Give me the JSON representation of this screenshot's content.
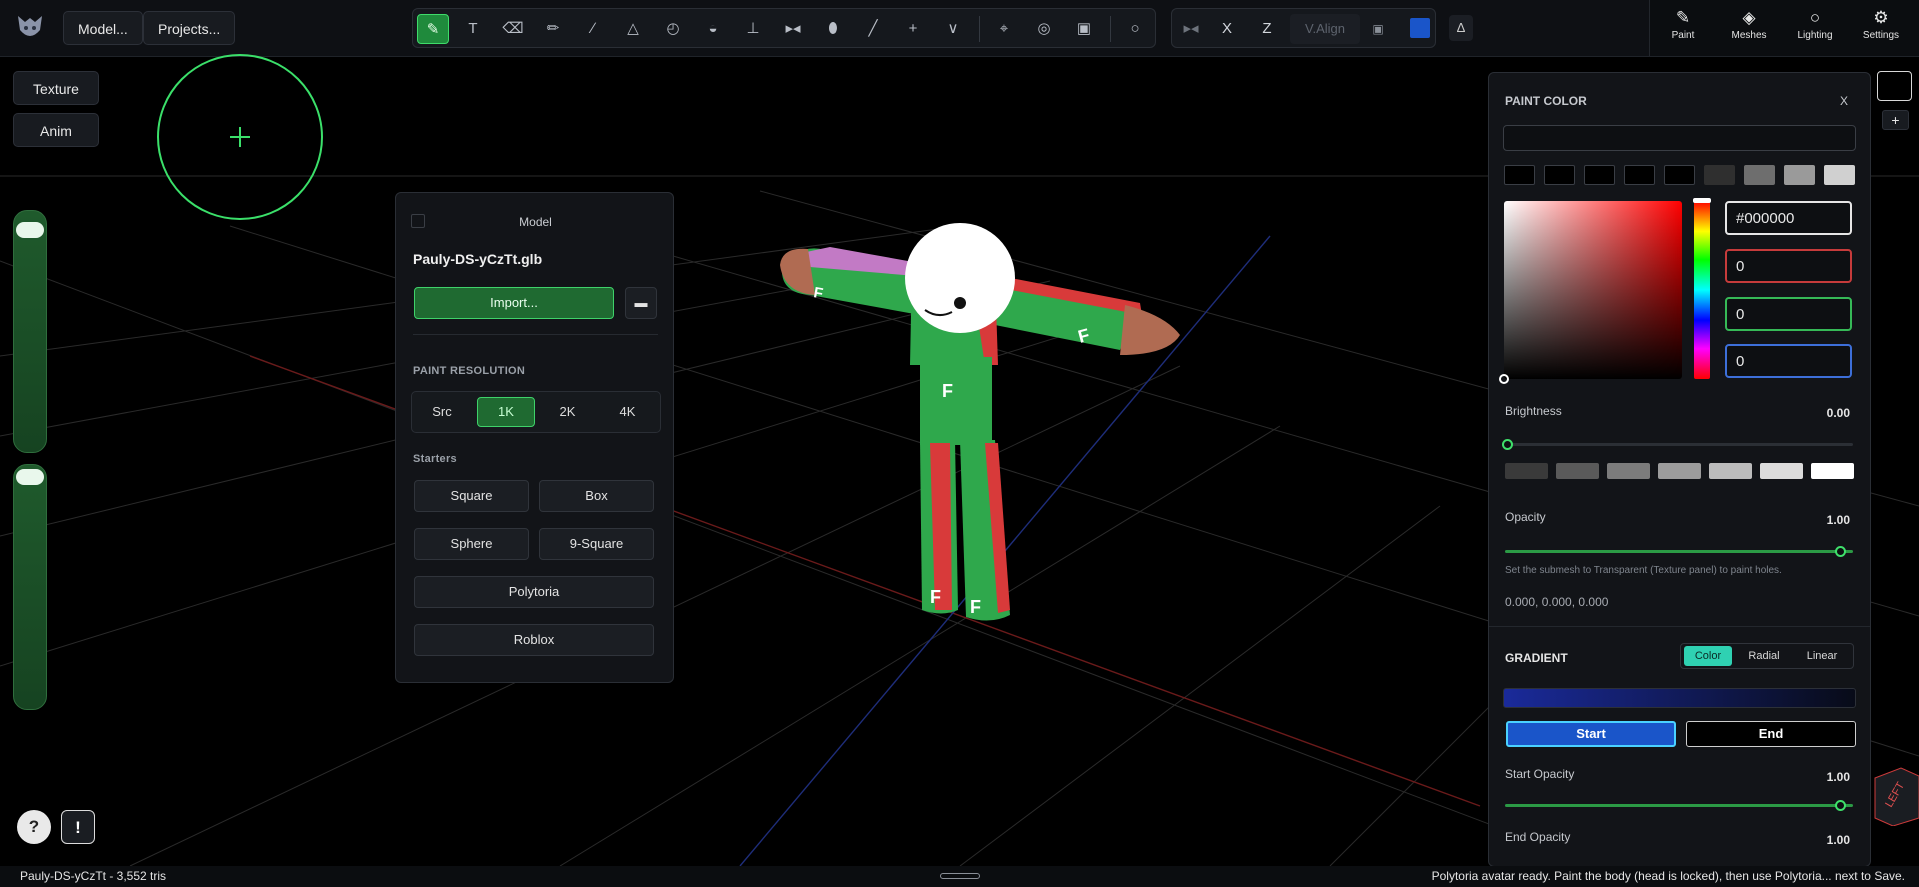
{
  "header": {
    "menus": [
      "Model...",
      "Projects..."
    ],
    "tools": [
      "brush-icon",
      "text-icon",
      "eraser-icon",
      "pencil-icon",
      "line-icon",
      "triangle-icon",
      "bucket-icon",
      "fill-icon",
      "stamp-icon",
      "mirror-icon",
      "ellipse-icon",
      "eyedropper-icon",
      "plus-icon",
      "chevron-down-icon",
      "target-icon",
      "crosshair-icon",
      "lock-icon",
      "lightbulb-icon"
    ],
    "axis": {
      "x_label": "X",
      "z_label": "Z",
      "valign_placeholder": "V.Align"
    },
    "accent_color": "#1a55c9",
    "right_nav": [
      {
        "label": "Paint",
        "icon": "brush-icon"
      },
      {
        "label": "Meshes",
        "icon": "layers-icon"
      },
      {
        "label": "Lighting",
        "icon": "lightbulb-icon"
      },
      {
        "label": "Settings",
        "icon": "gear-icon"
      }
    ]
  },
  "left": {
    "buttons": [
      "Texture",
      "Anim"
    ],
    "help_label": "?",
    "alert_label": "!"
  },
  "model_panel": {
    "title": "Model",
    "filename": "Pauly-DS-yCzTt.glb",
    "import_label": "Import...",
    "resolution_label": "PAINT RESOLUTION",
    "resolutions": [
      "Src",
      "1K",
      "2K",
      "4K"
    ],
    "active_resolution": "1K",
    "starters_label": "Starters",
    "starters": [
      "Square",
      "Box",
      "Sphere",
      "9-Square",
      "Polytoria",
      "Roblox"
    ]
  },
  "paint_panel": {
    "title": "PAINT COLOR",
    "close_label": "X",
    "swatches": [
      "#000000",
      "#000000",
      "#000000",
      "#000000",
      "#000000",
      "#2f2f2f",
      "#6e6e6e",
      "#9a9a9a",
      "#d0d0d0"
    ],
    "hex_value": "#000000",
    "rgb": [
      "0",
      "0",
      "0"
    ],
    "brightness_label": "Brightness",
    "brightness_value": "0.00",
    "gray_swatches": [
      "#3a3a3a",
      "#5a5a5a",
      "#7c7c7c",
      "#9c9c9c",
      "#bcbcbc",
      "#dcdcdc",
      "#ffffff"
    ],
    "opacity_label": "Opacity",
    "opacity_value": "1.00",
    "hint": "Set the submesh to Transparent (Texture panel) to paint holes.",
    "coords": "0.000,  0.000,  0.000",
    "gradient_label": "GRADIENT",
    "gradient_tabs": [
      "Color",
      "Radial",
      "Linear"
    ],
    "active_gradient_tab": "Color",
    "start_label": "Start",
    "end_label": "End",
    "start_opacity_label": "Start Opacity",
    "start_opacity_value": "1.00",
    "end_opacity_label": "End Opacity",
    "end_opacity_value": "1.00"
  },
  "statusbar": {
    "left": "Pauly-DS-yCzTt  -  3,552 tris",
    "right": "Polytoria avatar ready. Paint the body (head is locked), then use Polytoria... next to Save."
  }
}
